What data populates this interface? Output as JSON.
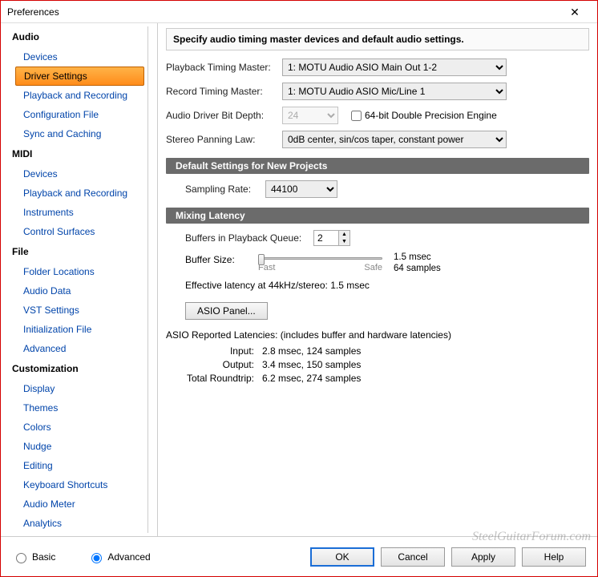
{
  "window": {
    "title": "Preferences",
    "close": "✕"
  },
  "sidebar": {
    "groups": [
      {
        "title": "Audio",
        "items": [
          "Devices",
          "Driver Settings",
          "Playback and Recording",
          "Configuration File",
          "Sync and Caching"
        ]
      },
      {
        "title": "MIDI",
        "items": [
          "Devices",
          "Playback and Recording",
          "Instruments",
          "Control Surfaces"
        ]
      },
      {
        "title": "File",
        "items": [
          "Folder Locations",
          "Audio Data",
          "VST Settings",
          "Initialization File",
          "Advanced"
        ]
      },
      {
        "title": "Customization",
        "items": [
          "Display",
          "Themes",
          "Colors",
          "Nudge",
          "Editing",
          "Keyboard Shortcuts",
          "Audio Meter",
          "Analytics"
        ]
      }
    ],
    "selected": "Driver Settings"
  },
  "main": {
    "heading": "Specify audio timing master devices and default audio settings.",
    "playback_timing_label": "Playback Timing Master:",
    "playback_timing_value": "1: MOTU Audio ASIO Main Out 1-2",
    "record_timing_label": "Record Timing Master:",
    "record_timing_value": "1: MOTU Audio ASIO Mic/Line 1",
    "bitdepth_label": "Audio Driver Bit Depth:",
    "bitdepth_value": "24",
    "precision_label": "64-bit Double Precision Engine",
    "panning_label": "Stereo Panning Law:",
    "panning_value": "0dB center, sin/cos taper, constant power",
    "section_defaults": "Default Settings for New Projects",
    "sampling_label": "Sampling Rate:",
    "sampling_value": "44100",
    "section_latency": "Mixing Latency",
    "buffers_label": "Buffers in Playback Queue:",
    "buffers_value": "2",
    "buffer_size_label": "Buffer Size:",
    "slider_fast": "Fast",
    "slider_safe": "Safe",
    "buffer_msec": "1.5 msec",
    "buffer_samples": "64 samples",
    "effective_latency": "Effective latency at 44kHz/stereo:  1.5 msec",
    "asio_panel": "ASIO Panel...",
    "reported_title": "ASIO Reported Latencies: (includes buffer and hardware latencies)",
    "input_label": "Input:",
    "input_value": "2.8 msec, 124 samples",
    "output_label": "Output:",
    "output_value": "3.4 msec, 150 samples",
    "roundtrip_label": "Total Roundtrip:",
    "roundtrip_value": "6.2 msec, 274 samples"
  },
  "footer": {
    "mode_basic": "Basic",
    "mode_advanced": "Advanced",
    "ok": "OK",
    "cancel": "Cancel",
    "apply": "Apply",
    "help": "Help"
  },
  "watermark": "SteelGuitarForum.com"
}
